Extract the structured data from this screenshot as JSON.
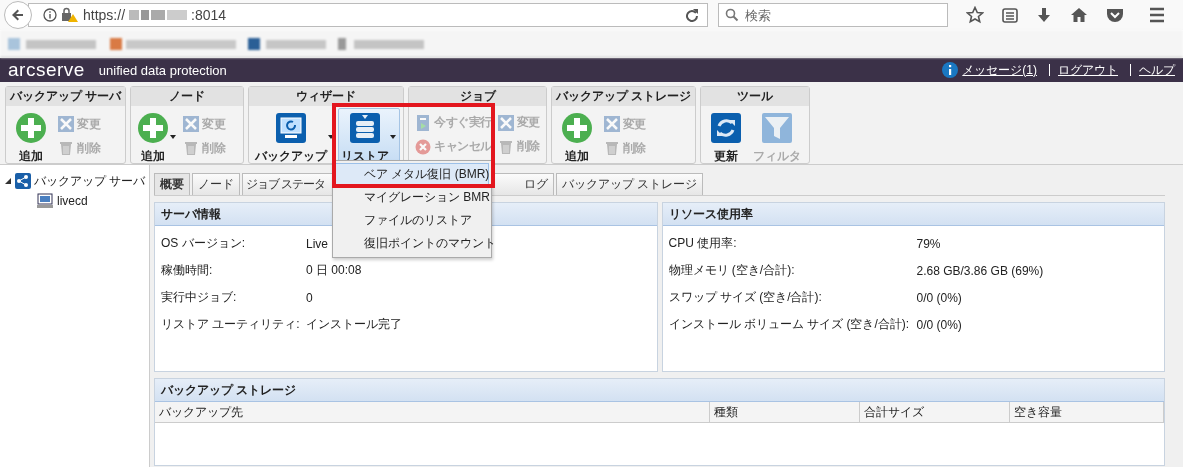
{
  "browser": {
    "url_scheme": "https://",
    "url_port": ":8014",
    "search_placeholder": "検索"
  },
  "header": {
    "logo": "arcserve",
    "product": "unified data protection",
    "links": [
      {
        "label": "メッセージ(1)",
        "kind": "info"
      },
      {
        "label": "ログアウト",
        "kind": "plain"
      },
      {
        "label": "ヘルプ",
        "kind": "plain"
      }
    ]
  },
  "toolbar": [
    {
      "title": "バックアップ サーバ",
      "columns": [
        {
          "buttons": [
            {
              "kind": "add",
              "label": "追加",
              "disabled": false,
              "dropdown": false,
              "pressed": false
            }
          ]
        },
        {
          "buttons": [
            {
              "kind": "edit",
              "label": "変更",
              "disabled": true
            },
            {
              "kind": "delete",
              "label": "削除",
              "disabled": true
            }
          ]
        }
      ]
    },
    {
      "title": "ノード",
      "columns": [
        {
          "buttons": [
            {
              "kind": "add",
              "label": "追加",
              "disabled": false,
              "dropdown": true,
              "pressed": false
            }
          ]
        },
        {
          "buttons": [
            {
              "kind": "edit",
              "label": "変更",
              "disabled": true
            },
            {
              "kind": "delete",
              "label": "削除",
              "disabled": true
            }
          ]
        }
      ]
    },
    {
      "title": "ウィザード",
      "columns": [
        {
          "buttons": [
            {
              "kind": "backup",
              "label": "バックアップ",
              "disabled": false,
              "dropdown": true,
              "pressed": false
            }
          ]
        },
        {
          "buttons": [
            {
              "kind": "restore",
              "label": "リストア",
              "disabled": false,
              "dropdown": true,
              "pressed": true
            }
          ]
        }
      ]
    },
    {
      "title": "ジョブ",
      "columns": [
        {
          "buttons": [
            {
              "kind": "run",
              "label": "今すぐ実行",
              "disabled": true
            },
            {
              "kind": "cancel",
              "label": "キャンセル",
              "disabled": true
            }
          ]
        },
        {
          "buttons": [
            {
              "kind": "edit",
              "label": "変更",
              "disabled": true
            },
            {
              "kind": "delete",
              "label": "削除",
              "disabled": true
            }
          ]
        }
      ]
    },
    {
      "title": "バックアップ ストレージ",
      "columns": [
        {
          "buttons": [
            {
              "kind": "add",
              "label": "追加",
              "disabled": false,
              "dropdown": false,
              "pressed": false
            }
          ]
        },
        {
          "buttons": [
            {
              "kind": "edit",
              "label": "変更",
              "disabled": true
            },
            {
              "kind": "delete",
              "label": "削除",
              "disabled": true
            }
          ]
        }
      ]
    },
    {
      "title": "ツール",
      "columns": [
        {
          "buttons": [
            {
              "kind": "refresh",
              "label": "更新",
              "disabled": false,
              "dropdown": false,
              "pressed": false
            }
          ]
        },
        {
          "buttons": [
            {
              "kind": "filter",
              "label": "フィルタ",
              "disabled": true,
              "dropdown": false,
              "pressed": false
            }
          ]
        }
      ]
    }
  ],
  "menu": [
    {
      "label": "ベア メタル復旧 (BMR)",
      "selected": true
    },
    {
      "label": "マイグレーション BMR",
      "selected": false
    },
    {
      "label": "ファイルのリストア",
      "selected": false
    },
    {
      "label": "復旧ポイントのマウント",
      "selected": false
    }
  ],
  "tree": [
    {
      "label": "バックアップ サーバ",
      "expanded": true,
      "children": [
        {
          "label": "livecd"
        }
      ]
    }
  ],
  "tabs": [
    {
      "label": "概要",
      "selected": true
    },
    {
      "label": "ノード",
      "selected": false
    },
    {
      "label": "ジョブ ステータ",
      "selected": false
    },
    {
      "label": "ログ",
      "selected": false
    },
    {
      "label": "バックアップ ストレージ",
      "selected": false
    }
  ],
  "server_info": {
    "title": "サーバ情報",
    "rows": [
      {
        "label": "OS バージョン:",
        "value": "Live"
      },
      {
        "label": "稼働時間:",
        "value": "0 日 00:08"
      },
      {
        "label": "実行中ジョブ:",
        "value": "0"
      },
      {
        "label": "リストア ユーティリティ:",
        "value": "インストール完了"
      }
    ]
  },
  "resources": {
    "title": "リソース使用率",
    "rows": [
      {
        "label": "CPU 使用率:",
        "value": "79%"
      },
      {
        "label": "物理メモリ (空き/合計):",
        "value": "2.68 GB/3.86 GB (69%)"
      },
      {
        "label": "スワップ サイズ (空き/合計):",
        "value": "0/0 (0%)"
      },
      {
        "label": "インストール ボリューム サイズ (空き/合計):",
        "value": "0/0 (0%)"
      }
    ]
  },
  "storage": {
    "title": "バックアップ ストレージ",
    "columns": [
      "バックアップ先",
      "種類",
      "合計サイズ",
      "空き容量"
    ]
  }
}
